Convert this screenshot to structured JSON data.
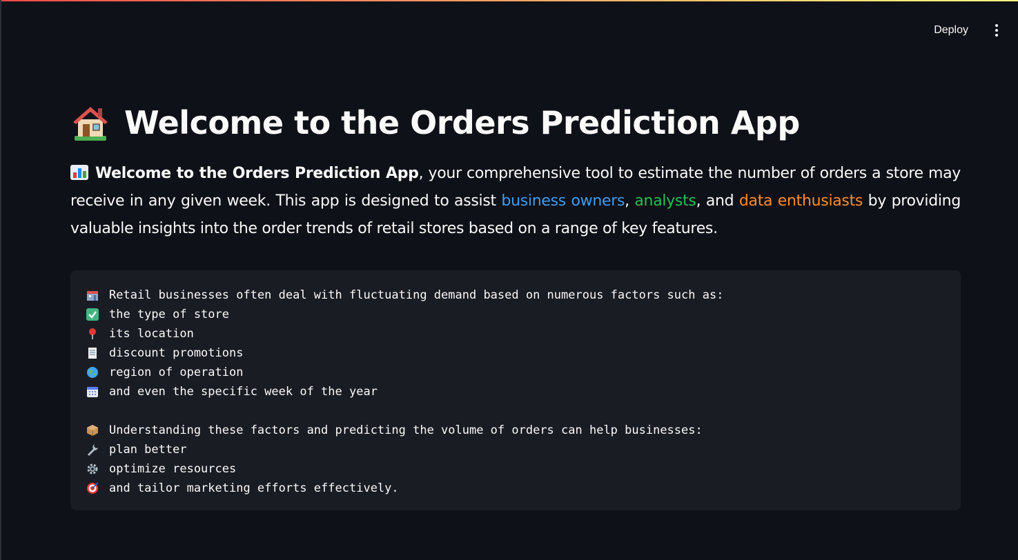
{
  "header": {
    "deploy_label": "Deploy",
    "menu_icon": "more-vertical-icon"
  },
  "main": {
    "title": "Welcome to the Orders Prediction App",
    "title_icon": "house-icon",
    "intro": {
      "icon": "bar-chart-icon",
      "bold": "Welcome to the Orders Prediction App",
      "text1": ", your comprehensive tool to estimate the number of orders a store may receive in any given week. This app is designed to assist ",
      "highlight1": "business owners",
      "sep1": ", ",
      "highlight2": "analysts",
      "sep2": ", and ",
      "highlight3": "data enthusiasts",
      "text2": " by providing valuable insights into the order trends of retail stores based on a range of key features."
    },
    "code_block": {
      "lines": [
        {
          "icon": "store-icon",
          "text": "Retail businesses often deal with fluctuating demand based on numerous factors such as:"
        },
        {
          "icon": "check-icon",
          "text": "the type of store"
        },
        {
          "icon": "pin-icon",
          "text": "its location"
        },
        {
          "icon": "receipt-icon",
          "text": "discount promotions"
        },
        {
          "icon": "globe-icon",
          "text": "region of operation"
        },
        {
          "icon": "calendar-icon",
          "text": "and even the specific week of the year"
        },
        {
          "icon": "",
          "text": ""
        },
        {
          "icon": "package-icon",
          "text": "Understanding these factors and predicting the volume of orders can help businesses:"
        },
        {
          "icon": "wrench-icon",
          "text": "plan better"
        },
        {
          "icon": "gear-icon",
          "text": "optimize resources"
        },
        {
          "icon": "target-icon",
          "text": "and tailor marketing efforts effectively."
        }
      ]
    }
  },
  "colors": {
    "background": "#0e1117",
    "code_background": "#1a1c24",
    "blue": "#3d9df3",
    "green": "#21c354",
    "orange": "#ff8c2b"
  }
}
